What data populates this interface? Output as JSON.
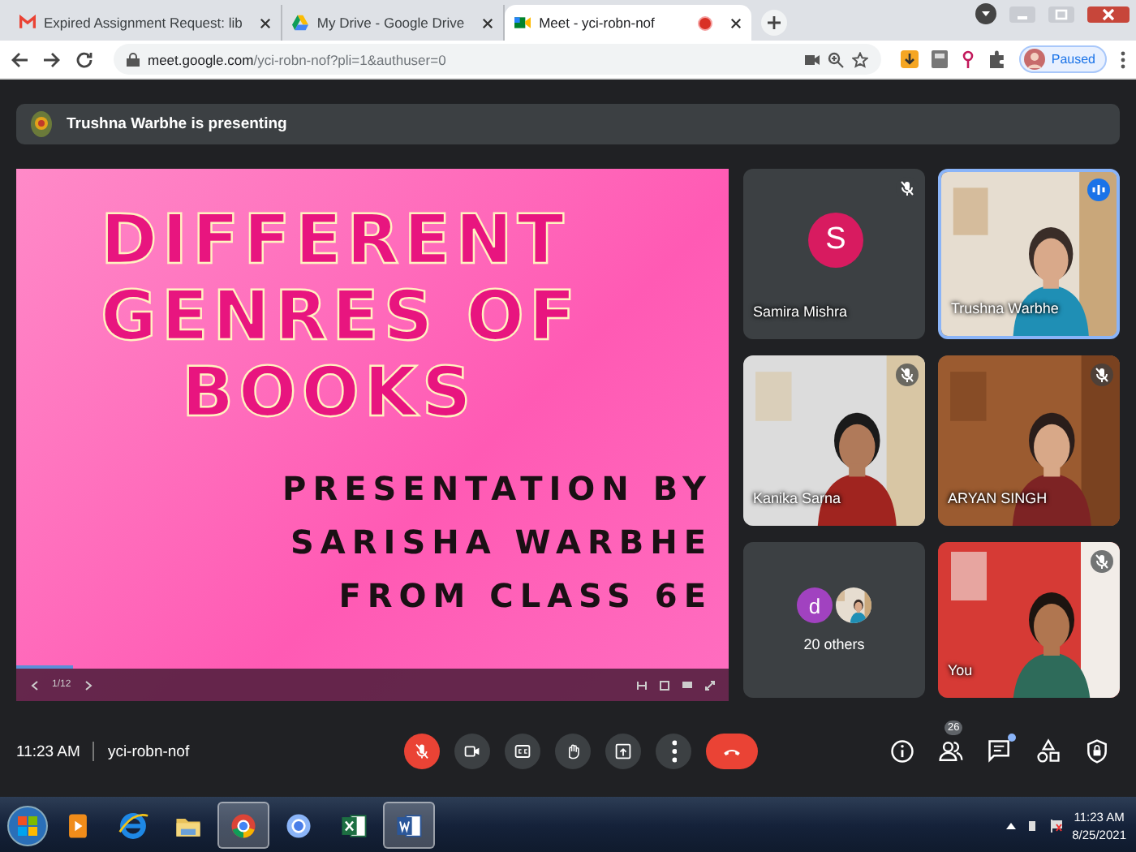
{
  "browser": {
    "tabs": [
      {
        "title": "Expired Assignment Request: lib",
        "kind": "gmail",
        "selected": false
      },
      {
        "title": "My Drive - Google Drive",
        "kind": "drive",
        "selected": false
      },
      {
        "title": "Meet - yci-robn-nof",
        "kind": "meet",
        "selected": true,
        "recording": true
      }
    ],
    "url_host": "meet.google.com",
    "url_path": "/yci-robn-nof?pli=1&authuser=0",
    "profile_status": "Paused"
  },
  "presenting_banner": "Trushna Warbhe is presenting",
  "slide": {
    "title_lines": [
      "DIFFERENT",
      "GENRES OF",
      "BOOKS"
    ],
    "subtitle_lines": [
      "PRESENTATION BY",
      "SARISHA WARBHE",
      "FROM CLASS 6E"
    ],
    "page": "1/12",
    "level": 0.08
  },
  "tiles": [
    {
      "kind": "avatar",
      "name": "Samira Mishra",
      "letter": "S",
      "muted": true,
      "speaking": false
    },
    {
      "kind": "video",
      "name": "Trushna Warbhe",
      "muted": false,
      "speaking": true
    },
    {
      "kind": "video",
      "name": "Kanika Sarna",
      "muted": true,
      "speaking": false
    },
    {
      "kind": "video",
      "name": "ARYAN SINGH",
      "muted": true,
      "speaking": false
    },
    {
      "kind": "others",
      "name": "20 others",
      "letter": "d"
    },
    {
      "kind": "video",
      "name": "You",
      "muted": true,
      "speaking": false
    }
  ],
  "meeting": {
    "time": "11:23 AM",
    "code": "yci-robn-nof"
  },
  "controls": [
    {
      "kind": "mic",
      "off": true
    },
    {
      "kind": "camera"
    },
    {
      "kind": "captions"
    },
    {
      "kind": "hand"
    },
    {
      "kind": "present"
    },
    {
      "kind": "more"
    },
    {
      "kind": "hangup"
    }
  ],
  "side_buttons": [
    {
      "kind": "info"
    },
    {
      "kind": "people",
      "badge": "26"
    },
    {
      "kind": "chat",
      "unread": true
    },
    {
      "kind": "activities"
    },
    {
      "kind": "lock"
    }
  ],
  "taskbar": {
    "apps": [
      {
        "kind": "media",
        "selected": false
      },
      {
        "kind": "ie",
        "selected": false
      },
      {
        "kind": "folder",
        "selected": false
      },
      {
        "kind": "chrome",
        "selected": true
      },
      {
        "kind": "chromium",
        "selected": false
      },
      {
        "kind": "excel",
        "selected": false
      },
      {
        "kind": "word",
        "selected": true
      }
    ],
    "time": "11:23 AM",
    "date": "8/25/2021"
  }
}
